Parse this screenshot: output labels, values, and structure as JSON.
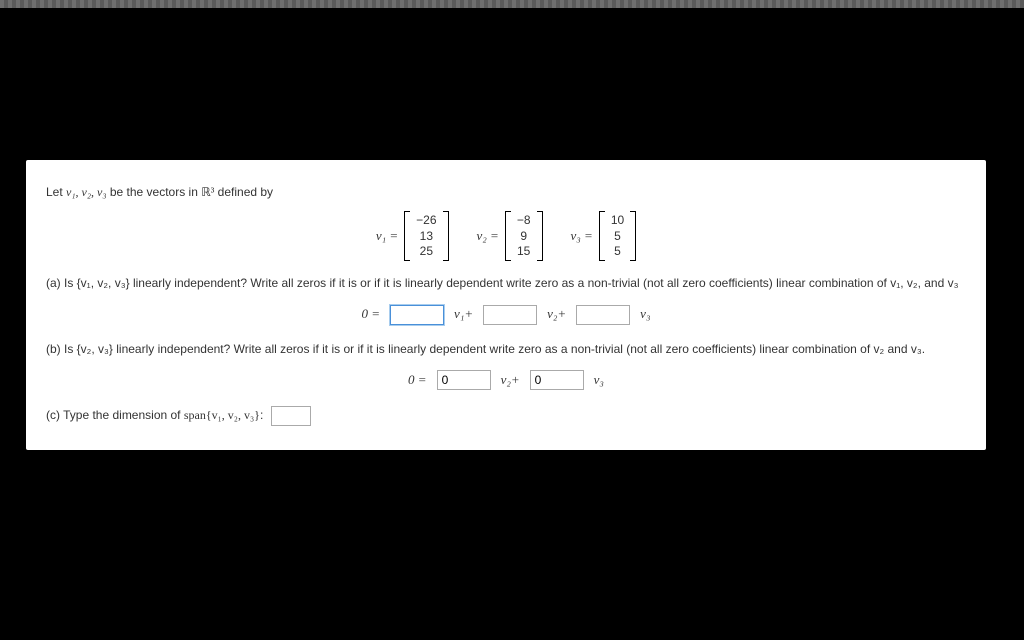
{
  "intro_prefix": "Let ",
  "intro_vecs": "v₁, v₂, v₃",
  "intro_mid": " be the vectors in ",
  "intro_space": "ℝ³",
  "intro_suffix": " defined by",
  "vectors": {
    "v1": {
      "label": "v₁ =",
      "vals": [
        "−26",
        "13",
        "25"
      ]
    },
    "v2": {
      "label": "v₂ =",
      "vals": [
        "−8",
        "9",
        "15"
      ]
    },
    "v3": {
      "label": "v₃ =",
      "vals": [
        "10",
        "5",
        "5"
      ]
    }
  },
  "parts": {
    "a": "(a) Is {v₁, v₂, v₃} linearly independent? Write all zeros if it is or if it is linearly dependent write zero as a non-trivial (not all zero coefficients) linear combination of v₁, v₂, and v₃",
    "b": "(b) Is {v₂, v₃} linearly independent? Write all zeros if it is or if it is linearly dependent write zero as a non-trivial (not all zero coefficients) linear combination of v₂ and v₃.",
    "c_prefix": "(c) Type the dimension of ",
    "c_span": "span{v₁, v₂, v₃}",
    "c_suffix": ":"
  },
  "equations": {
    "a": {
      "lhs": "0 =",
      "coef1": "",
      "term1": "v₁+",
      "coef2": "",
      "term2": "v₂+",
      "coef3": "",
      "term3": "v₃"
    },
    "b": {
      "lhs": "0 =",
      "coef1": "0",
      "term1": "v₂+",
      "coef2": "0",
      "term2": "v₃"
    }
  },
  "dim_value": ""
}
